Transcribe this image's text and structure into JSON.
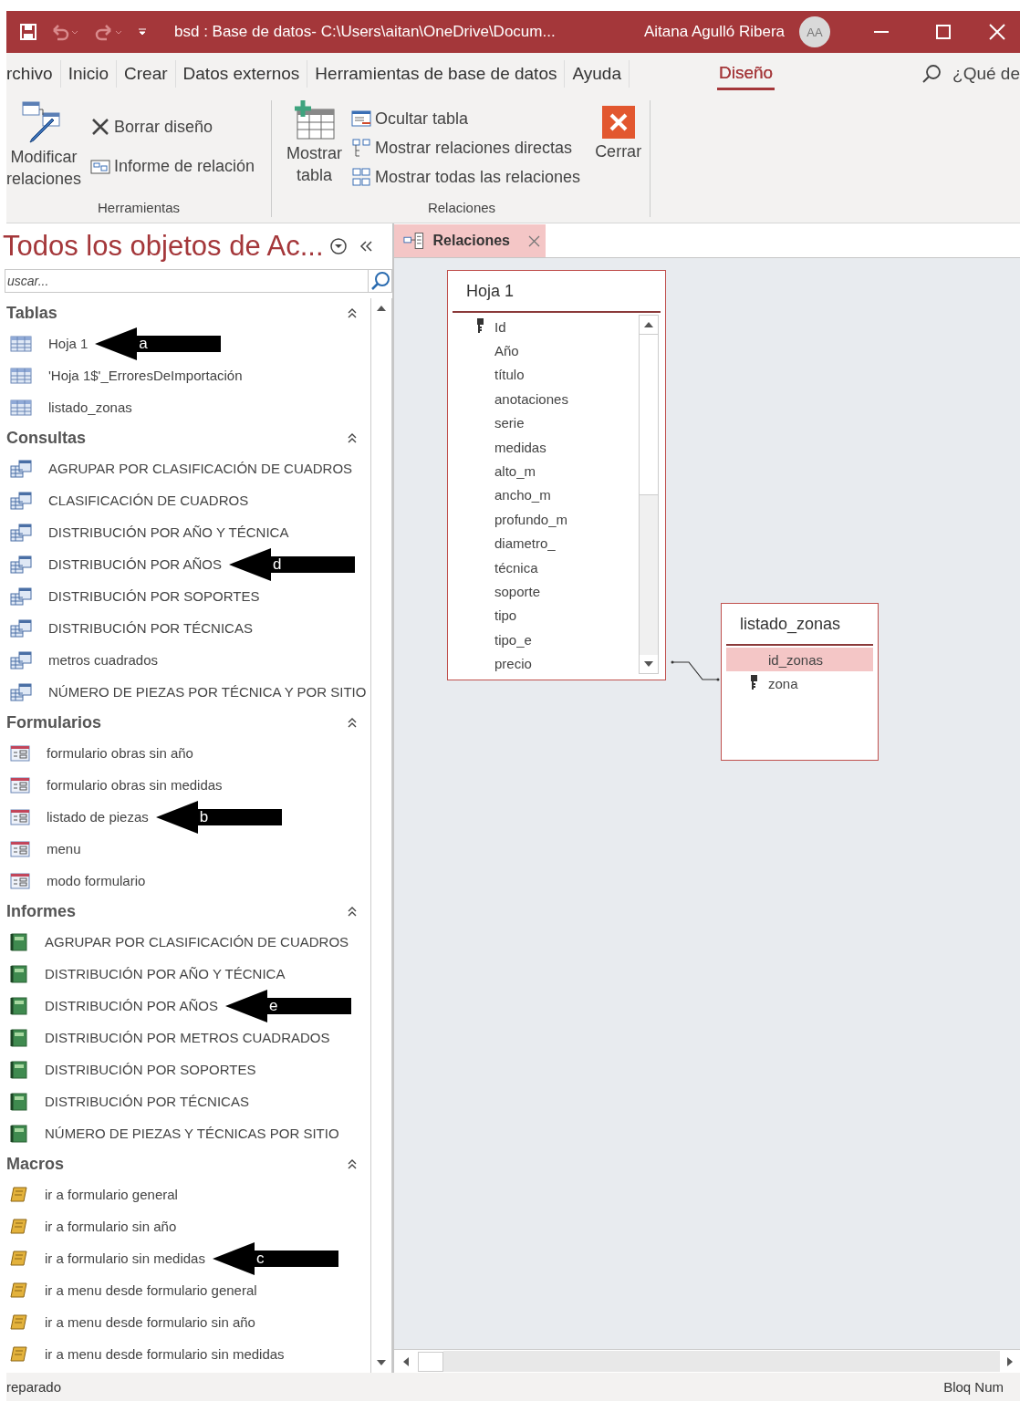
{
  "window": {
    "title": "bsd : Base de datos- C:\\Users\\aitan\\OneDrive\\Docum...",
    "user": "Aitana Agulló Ribera",
    "avatar": "AA"
  },
  "ribbon_tabs": [
    {
      "label": "rchivo",
      "selected": false
    },
    {
      "label": "Inicio",
      "selected": false
    },
    {
      "label": "Crear",
      "selected": false
    },
    {
      "label": "Datos externos",
      "selected": false
    },
    {
      "label": "Herramientas de base de datos",
      "selected": false
    },
    {
      "label": "Ayuda",
      "selected": false
    },
    {
      "label": "Diseño",
      "selected": true
    }
  ],
  "tell_me": "¿Qué de",
  "ribbon_groups": [
    {
      "label": "Herramientas",
      "large": [
        {
          "kind": "edit",
          "lines": [
            "Modificar",
            "relaciones"
          ]
        }
      ],
      "small": [
        {
          "kind": "clear",
          "label": "Borrar diseño"
        },
        {
          "kind": "report",
          "label": "Informe de relación"
        }
      ]
    },
    {
      "label": "Relaciones",
      "large": [
        {
          "kind": "addtable",
          "lines": [
            "Mostrar",
            "tabla"
          ]
        }
      ],
      "small": [
        {
          "kind": "hide",
          "label": "Ocultar tabla"
        },
        {
          "kind": "direct",
          "label": "Mostrar relaciones directas"
        },
        {
          "kind": "all",
          "label": "Mostrar todas las relaciones"
        }
      ],
      "after": [
        {
          "kind": "close",
          "lines": [
            "Cerrar"
          ]
        }
      ]
    }
  ],
  "nav": {
    "title": "Todos los objetos de Ac...",
    "search": {
      "placeholder": "uscar..."
    },
    "sections": [
      {
        "title": "Tablas",
        "kind": "table",
        "items": [
          {
            "label": "Hoja 1",
            "annotation": "a"
          },
          {
            "label": "'Hoja 1$'_ErroresDeImportación"
          },
          {
            "label": "listado_zonas"
          }
        ]
      },
      {
        "title": "Consultas",
        "kind": "query",
        "items": [
          {
            "label": "AGRUPAR POR CLASIFICACIÓN DE CUADROS"
          },
          {
            "label": "CLASIFICACIÓN DE CUADROS"
          },
          {
            "label": "DISTRIBUCIÓN POR AÑO Y TÉCNICA"
          },
          {
            "label": "DISTRIBUCIÓN POR AÑOS",
            "annotation": "d"
          },
          {
            "label": "DISTRIBUCIÓN POR SOPORTES"
          },
          {
            "label": "DISTRIBUCIÓN POR TÉCNICAS"
          },
          {
            "label": "metros cuadrados"
          },
          {
            "label": "NÚMERO DE PIEZAS POR TÉCNICA Y POR SITIO"
          }
        ]
      },
      {
        "title": "Formularios",
        "kind": "form",
        "items": [
          {
            "label": "formulario obras sin año"
          },
          {
            "label": "formulario obras sin medidas"
          },
          {
            "label": "listado de piezas",
            "annotation": "b"
          },
          {
            "label": "menu"
          },
          {
            "label": "modo formulario"
          }
        ]
      },
      {
        "title": "Informes",
        "kind": "report",
        "items": [
          {
            "label": "AGRUPAR POR CLASIFICACIÓN DE CUADROS"
          },
          {
            "label": "DISTRIBUCIÓN POR AÑO Y TÉCNICA"
          },
          {
            "label": "DISTRIBUCIÓN POR AÑOS",
            "annotation": "e"
          },
          {
            "label": "DISTRIBUCIÓN POR METROS CUADRADOS"
          },
          {
            "label": "DISTRIBUCIÓN POR SOPORTES"
          },
          {
            "label": "DISTRIBUCIÓN POR TÉCNICAS"
          },
          {
            "label": "NÚMERO DE PIEZAS Y TÉCNICAS POR SITIO"
          }
        ]
      },
      {
        "title": "Macros",
        "kind": "macro",
        "items": [
          {
            "label": "ir a formulario general"
          },
          {
            "label": "ir a formulario sin año"
          },
          {
            "label": "ir a formulario sin medidas",
            "annotation": "c"
          },
          {
            "label": "ir a menu desde formulario general"
          },
          {
            "label": "ir a menu desde formulario sin año"
          },
          {
            "label": "ir a menu desde formulario sin medidas"
          }
        ]
      }
    ]
  },
  "document_tab": {
    "label": "Relaciones"
  },
  "tables": [
    {
      "title": "Hoja 1",
      "fields": [
        {
          "name": "Id",
          "key": true,
          "selected": false
        },
        {
          "name": "Año",
          "key": false,
          "selected": false
        },
        {
          "name": "título",
          "key": false,
          "selected": false
        },
        {
          "name": "anotaciones",
          "key": false,
          "selected": false
        },
        {
          "name": "serie",
          "key": false,
          "selected": false
        },
        {
          "name": "medidas",
          "key": false,
          "selected": false
        },
        {
          "name": "alto_m",
          "key": false,
          "selected": false
        },
        {
          "name": "ancho_m",
          "key": false,
          "selected": false
        },
        {
          "name": "profundo_m",
          "key": false,
          "selected": false
        },
        {
          "name": "diametro_",
          "key": false,
          "selected": false
        },
        {
          "name": "técnica",
          "key": false,
          "selected": false
        },
        {
          "name": "soporte",
          "key": false,
          "selected": false
        },
        {
          "name": "tipo",
          "key": false,
          "selected": false
        },
        {
          "name": "tipo_e",
          "key": false,
          "selected": false
        },
        {
          "name": "precio",
          "key": false,
          "selected": false
        }
      ]
    },
    {
      "title": "listado_zonas",
      "fields": [
        {
          "name": "id_zonas",
          "key": false,
          "selected": true
        },
        {
          "name": "zona",
          "key": true,
          "selected": false
        }
      ]
    }
  ],
  "status_bar": {
    "left": "reparado",
    "right": "Bloq Num"
  }
}
